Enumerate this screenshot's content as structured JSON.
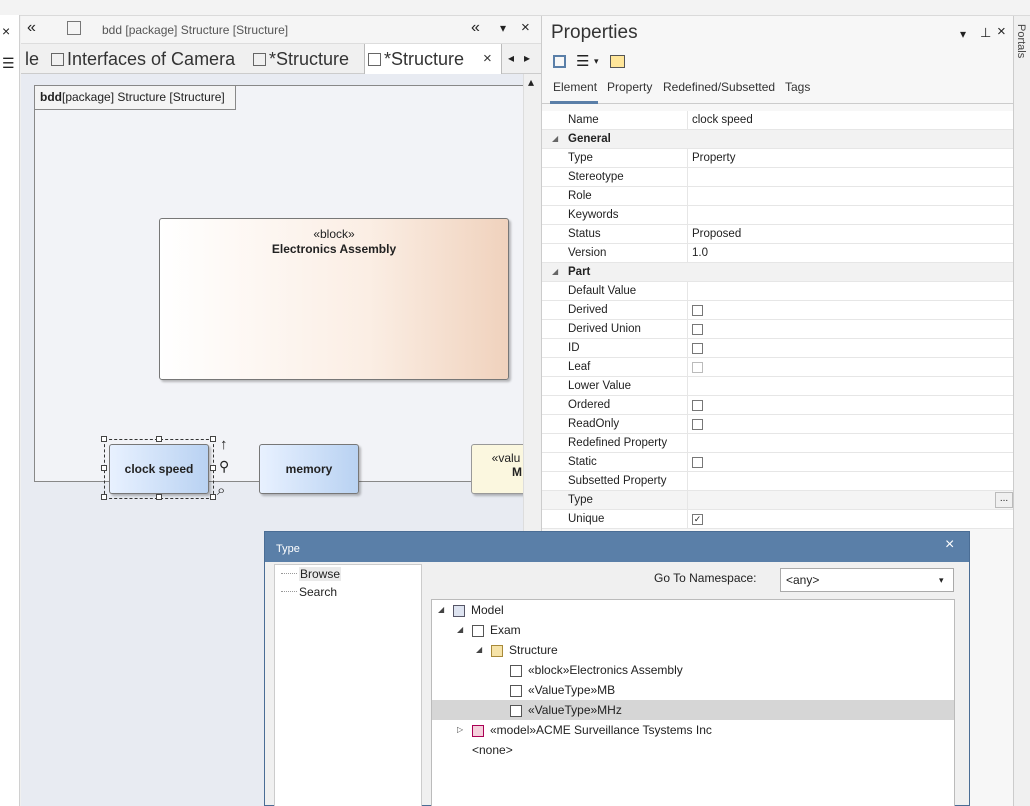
{
  "diagram_window": {
    "title": "bdd [package] Structure [Structure]",
    "tabs": [
      {
        "label": "le"
      },
      {
        "label": "Interfaces of Camera"
      },
      {
        "label": "*Structure"
      },
      {
        "label": "*Structure"
      }
    ],
    "frame_label_bold": "bdd",
    "frame_label_rest": "[package] Structure [Structure]",
    "blocks": {
      "electronics_stereotype": "«block»",
      "electronics_name": "Electronics Assembly",
      "clock": "clock speed",
      "memory": "memory",
      "valuetype_stereotype": "«valu",
      "valuetype_name": "M"
    }
  },
  "properties": {
    "title": "Properties",
    "tabs": [
      "Element",
      "Property",
      "Redefined/Subsetted",
      "Tags"
    ],
    "rows": [
      {
        "name": "Name",
        "value": "clock speed"
      },
      {
        "name": "General",
        "category": true
      },
      {
        "name": "Type",
        "value": "Property"
      },
      {
        "name": "Stereotype",
        "value": ""
      },
      {
        "name": "Role",
        "value": ""
      },
      {
        "name": "Keywords",
        "value": ""
      },
      {
        "name": "Status",
        "value": "Proposed"
      },
      {
        "name": "Version",
        "value": "1.0"
      },
      {
        "name": "Part",
        "category": true
      },
      {
        "name": "Default Value",
        "value": ""
      },
      {
        "name": "Derived",
        "check": "off"
      },
      {
        "name": "Derived Union",
        "check": "off"
      },
      {
        "name": "ID",
        "check": "off"
      },
      {
        "name": "Leaf",
        "check": "disabled"
      },
      {
        "name": "Lower Value",
        "value": ""
      },
      {
        "name": "Ordered",
        "check": "off"
      },
      {
        "name": "ReadOnly",
        "check": "off"
      },
      {
        "name": "Redefined Property",
        "value": ""
      },
      {
        "name": "Static",
        "check": "off"
      },
      {
        "name": "Subsetted Property",
        "value": ""
      },
      {
        "name": "Type",
        "value": "",
        "ellipsis": "..."
      },
      {
        "name": "Unique",
        "check": "on"
      }
    ]
  },
  "portals_label": "Portals",
  "type_dialog": {
    "title": "Type",
    "left_items": [
      "Browse",
      "Search"
    ],
    "namespace_label": "Go To Namespace:",
    "namespace_value": "<any>",
    "tree": [
      {
        "label": "Model",
        "level": 0,
        "expander": "◢",
        "icon": "package"
      },
      {
        "label": "Exam",
        "level": 1,
        "expander": "◢",
        "icon": "model"
      },
      {
        "label": "Structure",
        "level": 2,
        "expander": "◢",
        "icon": "folder"
      },
      {
        "label": "«block»Electronics Assembly",
        "level": 3,
        "expander": "",
        "icon": "class"
      },
      {
        "label": "«ValueType»MB",
        "level": 3,
        "expander": "",
        "icon": "class"
      },
      {
        "label": "«ValueType»MHz",
        "level": 3,
        "expander": "",
        "icon": "class",
        "selected": true
      },
      {
        "label": "«model»ACME Surveillance Tsystems Inc",
        "level": 1,
        "expander": "▷",
        "icon": "model-pink"
      },
      {
        "label": "<none>",
        "level": 1,
        "expander": "",
        "icon": ""
      }
    ],
    "close_glyph": "×"
  },
  "glyphs": {
    "close": "×",
    "dropdown": "▾",
    "pin": "⊥",
    "double_left": "«",
    "scroll_left": "◂",
    "scroll_right": "▸",
    "scroll_up": "▴"
  },
  "colors": {
    "dialog_titlebar": "#5a7fa8",
    "selection": "#d6d6d6",
    "block_blue": "#b9d2f2",
    "block_peach": "#f0d2bd"
  }
}
